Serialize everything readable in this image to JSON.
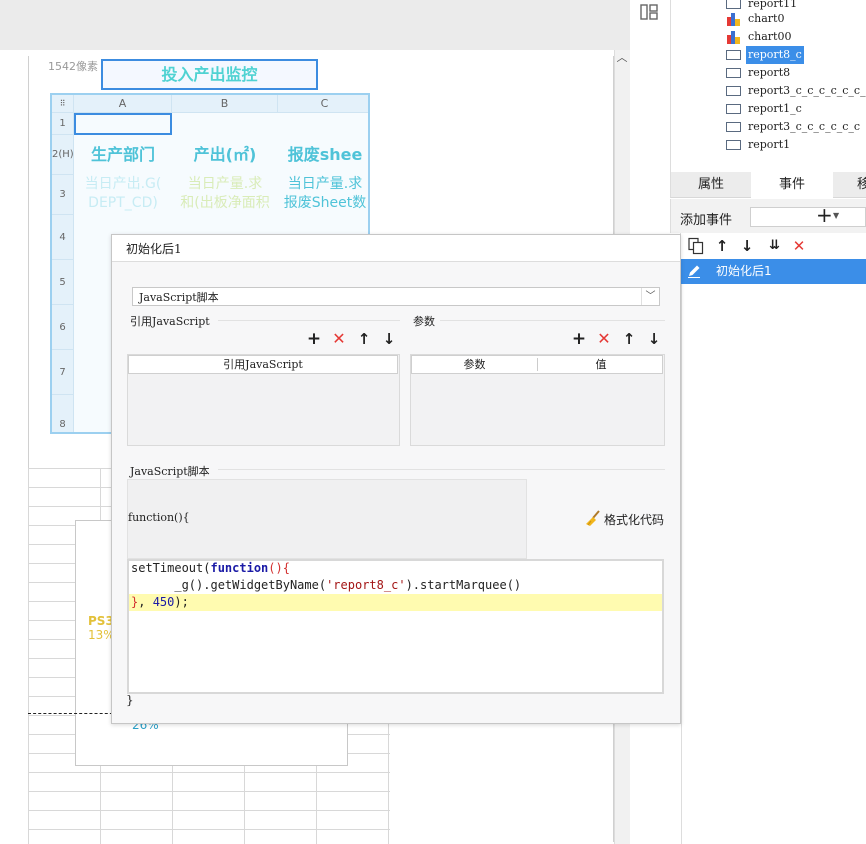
{
  "canvas": {
    "pixel_label": "1542像素",
    "title_widget": "投入产出监控",
    "sheet": {
      "columns": [
        "A",
        "B",
        "C"
      ],
      "rows": [
        "1",
        "2(H)",
        "3",
        "4",
        "5",
        "6",
        "7",
        "8"
      ],
      "headers": [
        "生产部门",
        "产出(㎡)",
        "报废shee"
      ],
      "descriptions": [
        {
          "line1": "当日产出.G(",
          "line2": "DEPT_CD)"
        },
        {
          "line1": "当日产量.求",
          "line2": "和(出板净面积"
        },
        {
          "line1": "当日产量.求",
          "line2": "报废Sheet数"
        }
      ]
    },
    "chart_labels": [
      "PS3",
      "13%",
      "26%"
    ]
  },
  "tree": {
    "items": [
      {
        "label": "report11",
        "type": "report"
      },
      {
        "label": "chart0",
        "type": "chart"
      },
      {
        "label": "chart00",
        "type": "chart"
      },
      {
        "label": "report8_c",
        "type": "report",
        "selected": true
      },
      {
        "label": "report8",
        "type": "report"
      },
      {
        "label": "report3_c_c_c_c_c_c_c",
        "type": "report"
      },
      {
        "label": "report1_c",
        "type": "report"
      },
      {
        "label": "report3_c_c_c_c_c_c",
        "type": "report"
      },
      {
        "label": "report1",
        "type": "report"
      }
    ]
  },
  "tabs": [
    {
      "label": "属性",
      "active": false
    },
    {
      "label": "事件",
      "active": true
    },
    {
      "label": "移",
      "active": false
    }
  ],
  "events": {
    "add_label": "添加事件",
    "add_icon": "plus-icon",
    "items": [
      {
        "label": "初始化后1",
        "selected": true
      }
    ]
  },
  "dialog": {
    "title": "初始化后1",
    "script_type": "JavaScript脚本",
    "ref_section": "引用JavaScript",
    "param_section": "参数",
    "ref_table_header": "引用JavaScript",
    "param_table_headers": [
      "参数",
      "值"
    ],
    "script_section": "JavaScript脚本",
    "function_signature": "function(){",
    "format_button": "格式化代码",
    "code": {
      "line1_a": "setTimeout(",
      "line1_kw": "function",
      "line1_b": "(){",
      "line2_a": "      _g",
      "line2_b": "().getWidgetByName(",
      "line2_str": "'report8_c'",
      "line2_c": ").startMarquee()",
      "line3_a": "}",
      "line3_b": ", ",
      "line3_num": "450",
      "line3_c": ");"
    },
    "closing": "}"
  },
  "colors": {
    "accent": "#3b8ee8",
    "title_text": "#4fd2d2",
    "delete_red": "#e53935",
    "code_highlight": "#fffbb0"
  }
}
